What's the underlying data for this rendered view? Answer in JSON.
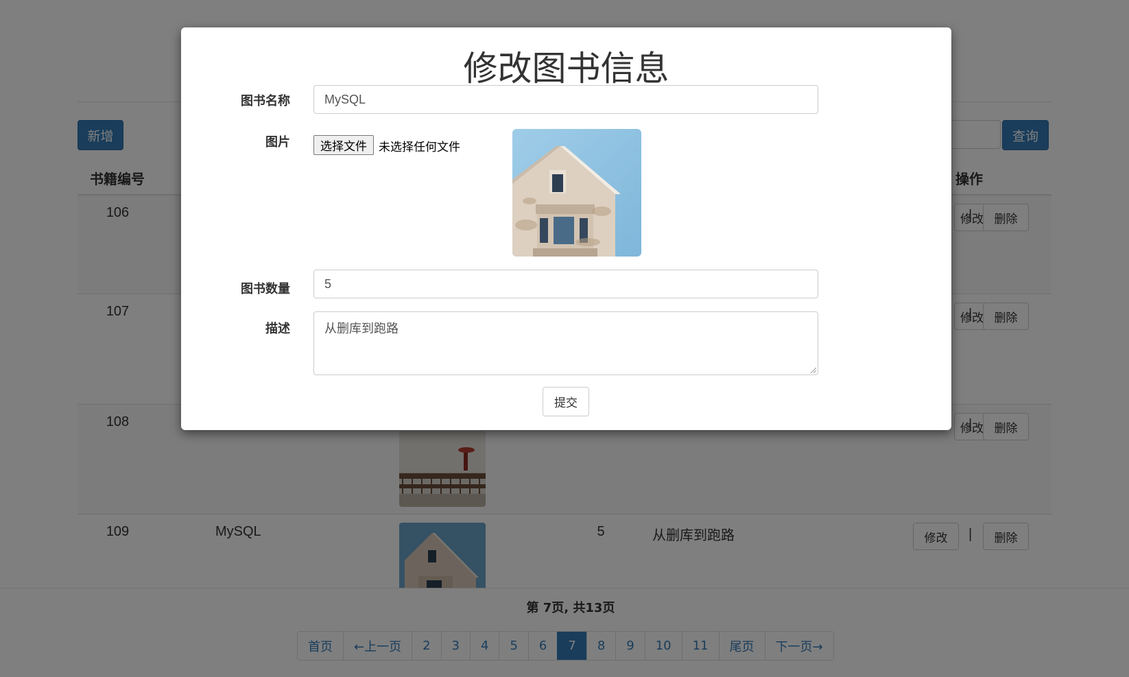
{
  "toolbar": {
    "add_label": "新增",
    "search_label": "查询"
  },
  "table": {
    "headers": {
      "id": "书籍编号",
      "actions": "操作"
    },
    "rows": [
      {
        "id": "106",
        "name": "",
        "count": "",
        "desc": "",
        "edit": "修改",
        "delete": "删除"
      },
      {
        "id": "107",
        "name": "",
        "count": "",
        "desc": "",
        "edit": "修改",
        "delete": "删除"
      },
      {
        "id": "108",
        "name": "",
        "count": "",
        "desc": "",
        "edit": "修改",
        "delete": "删除"
      },
      {
        "id": "109",
        "name": "MySQL",
        "count": "5",
        "desc": "从删库到跑路",
        "edit": "修改",
        "delete": "删除"
      }
    ],
    "separator": "|"
  },
  "pagination": {
    "info": "第 7页, 共13页",
    "items": [
      "首页",
      "←上一页",
      "2",
      "3",
      "4",
      "5",
      "6",
      "7",
      "8",
      "9",
      "10",
      "11",
      "尾页",
      "下一页→"
    ],
    "active": "7"
  },
  "modal": {
    "title": "修改图书信息",
    "name_label": "图书名称",
    "name_value": "MySQL",
    "image_label": "图片",
    "file_button": "选择文件",
    "file_status": "未选择任何文件",
    "count_label": "图书数量",
    "count_value": "5",
    "desc_label": "描述",
    "desc_value": "从删库到跑路",
    "submit_label": "提交"
  },
  "colors": {
    "primary": "#337ab7",
    "backdrop": "rgba(0,0,0,0.5)"
  }
}
